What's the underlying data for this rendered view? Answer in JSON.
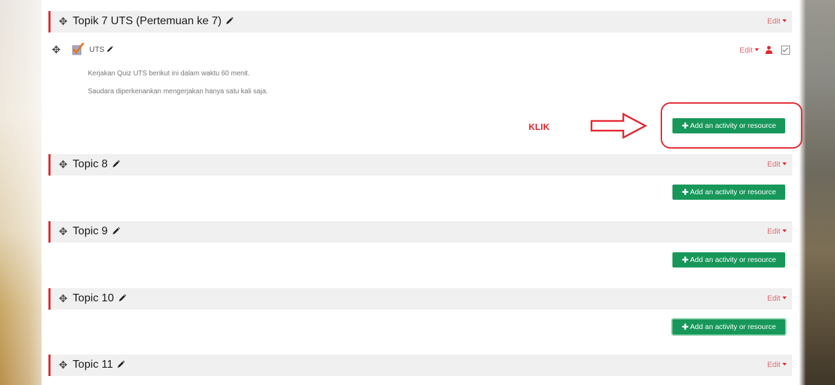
{
  "sections": [
    {
      "title": "Topik 7 UTS (Pertemuan ke 7)",
      "edit_label": "Edit"
    },
    {
      "title": "Topic 8",
      "edit_label": "Edit"
    },
    {
      "title": "Topic 9",
      "edit_label": "Edit"
    },
    {
      "title": "Topic 10",
      "edit_label": "Edit"
    },
    {
      "title": "Topic 11",
      "edit_label": "Edit"
    }
  ],
  "activity": {
    "name": "UTS",
    "edit_label": "Edit",
    "desc_line1": "Kerjakan Quiz UTS berikut ini dalam waktu 60 menit.",
    "desc_line2": "Saudara diperkenankan mengerjakan hanya satu kali saja."
  },
  "add_button_label": "Add an activity or resource",
  "annotation": {
    "klik": "KLIK"
  },
  "colors": {
    "accent_red": "#e2262f",
    "button_green": "#17985a",
    "header_bg": "#f0f0f0"
  },
  "icons": {
    "move": "move-icon",
    "edit": "pencil-icon",
    "quiz": "quiz-icon",
    "user": "user-icon",
    "completion": "checkbox-icon"
  }
}
